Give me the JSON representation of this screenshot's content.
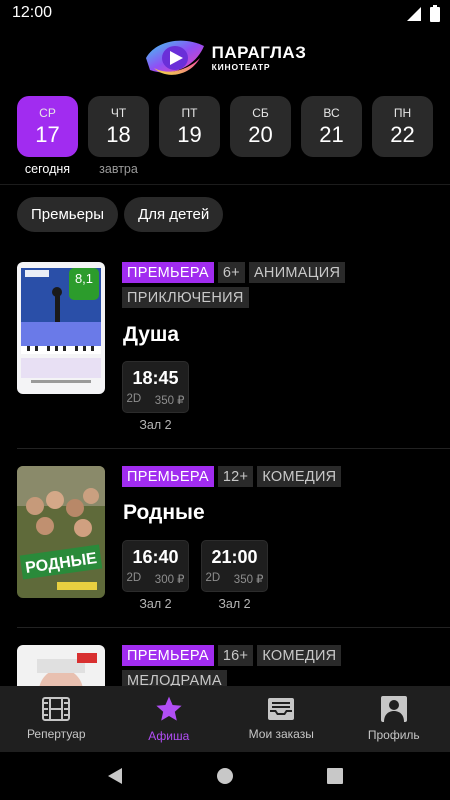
{
  "status": {
    "time": "12:00"
  },
  "brand": {
    "name": "ПАРАГЛАЗ",
    "subtitle": "КИНОТЕАТР"
  },
  "dates": [
    {
      "dow": "СР",
      "day": "17",
      "caption": "сегодня",
      "active": true
    },
    {
      "dow": "ЧТ",
      "day": "18",
      "caption": "завтра",
      "active": false
    },
    {
      "dow": "ПТ",
      "day": "19",
      "caption": "",
      "active": false
    },
    {
      "dow": "СБ",
      "day": "20",
      "caption": "",
      "active": false
    },
    {
      "dow": "ВС",
      "day": "21",
      "caption": "",
      "active": false
    },
    {
      "dow": "ПН",
      "day": "22",
      "caption": "",
      "active": false
    }
  ],
  "filters": [
    "Премьеры",
    "Для детей"
  ],
  "movies": [
    {
      "title": "Душа",
      "rating": "8,1",
      "tags": [
        "ПРЕМЬЕРА",
        "6+",
        "АНИМАЦИЯ",
        "ПРИКЛЮЧЕНИЯ"
      ],
      "sessions": [
        {
          "time": "18:45",
          "format": "2D",
          "price": "350 ₽",
          "hall": "Зал 2"
        }
      ]
    },
    {
      "title": "Родные",
      "tags": [
        "ПРЕМЬЕРА",
        "12+",
        "КОМЕДИЯ"
      ],
      "sessions": [
        {
          "time": "16:40",
          "format": "2D",
          "price": "300 ₽",
          "hall": "Зал 2"
        },
        {
          "time": "21:00",
          "format": "2D",
          "price": "350 ₽",
          "hall": "Зал 2"
        }
      ]
    },
    {
      "title": "",
      "tags": [
        "ПРЕМЬЕРА",
        "16+",
        "КОМЕДИЯ",
        "МЕЛОДРАМА"
      ],
      "sessions": []
    }
  ],
  "nav": [
    {
      "label": "Репертуар",
      "icon": "film-icon",
      "active": false
    },
    {
      "label": "Афиша",
      "icon": "star-icon",
      "active": true
    },
    {
      "label": "Мои заказы",
      "icon": "tray-icon",
      "active": false
    },
    {
      "label": "Профиль",
      "icon": "person-icon",
      "active": false
    }
  ],
  "colors": {
    "accent": "#a12cf0",
    "rating": "#2c9c2c",
    "background": "#000000"
  }
}
